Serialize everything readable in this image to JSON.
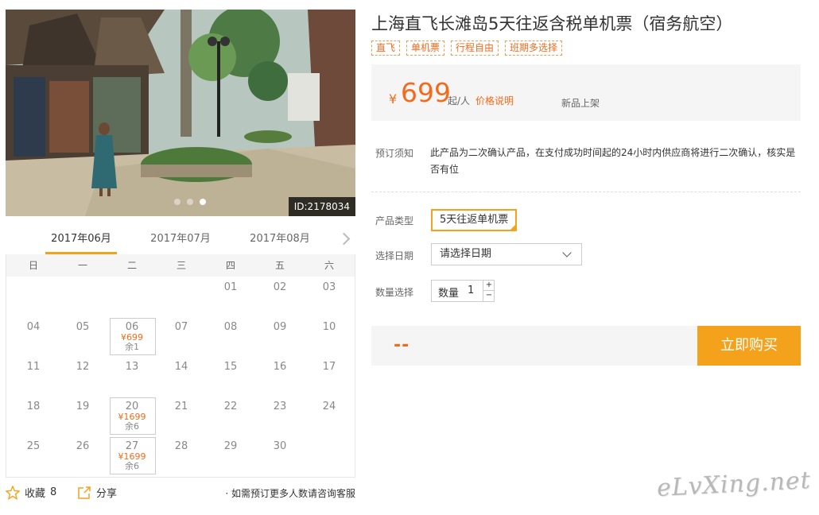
{
  "photo": {
    "id_label": "ID:2178034",
    "slides": 3,
    "active_slide": 3
  },
  "calendar": {
    "tabs": [
      "2017年06月",
      "2017年07月",
      "2017年08月"
    ],
    "active_tab": 0,
    "weekdays": [
      "日",
      "一",
      "二",
      "三",
      "四",
      "五",
      "六"
    ],
    "weeks": [
      [
        null,
        null,
        null,
        null,
        {
          "d": "01"
        },
        {
          "d": "02"
        },
        {
          "d": "03"
        }
      ],
      [
        {
          "d": "04"
        },
        {
          "d": "05"
        },
        {
          "d": "06",
          "price": "¥699",
          "left": "余1"
        },
        {
          "d": "07"
        },
        {
          "d": "08"
        },
        {
          "d": "09"
        },
        {
          "d": "10"
        }
      ],
      [
        {
          "d": "11"
        },
        {
          "d": "12"
        },
        {
          "d": "13"
        },
        {
          "d": "14"
        },
        {
          "d": "15"
        },
        {
          "d": "16"
        },
        {
          "d": "17"
        }
      ],
      [
        {
          "d": "18"
        },
        {
          "d": "19"
        },
        {
          "d": "20",
          "price": "¥1699",
          "left": "余6"
        },
        {
          "d": "21"
        },
        {
          "d": "22"
        },
        {
          "d": "23"
        },
        {
          "d": "24"
        }
      ],
      [
        {
          "d": "25"
        },
        {
          "d": "26"
        },
        {
          "d": "27",
          "price": "¥1699",
          "left": "余6"
        },
        {
          "d": "28"
        },
        {
          "d": "29"
        },
        {
          "d": "30"
        },
        null
      ]
    ]
  },
  "share_row": {
    "fav_label": "收藏",
    "fav_count": "8",
    "share_label": "分享",
    "note": "· 如需预订更多人数请咨询客服"
  },
  "product": {
    "title": "上海直飞长滩岛5天往返含税单机票（宿务航空）",
    "tags": [
      "直飞",
      "单机票",
      "行程自由",
      "班期多选择"
    ],
    "price": {
      "yen": "¥",
      "amount": "699",
      "unit": "起/人",
      "link": "价格说明",
      "new_label": "新品上架"
    },
    "booking_label": "预订须知",
    "booking_text": "此产品为二次确认产品，在支付成功时间起的24小时内供应商将进行二次确认，核实是否有位",
    "type_label": "产品类型",
    "type_value": "5天往返单机票",
    "date_label": "选择日期",
    "date_value": "请选择日期",
    "qty_label": "数量选择",
    "qty_field_label": "数量",
    "qty_value": "1",
    "qty_plus": "+",
    "qty_minus": "−",
    "total": "--",
    "buy_label": "立即购买"
  },
  "watermark": "eLvXing.net",
  "colors": {
    "accent": "#f4a21c",
    "price": "#f26b1d"
  }
}
